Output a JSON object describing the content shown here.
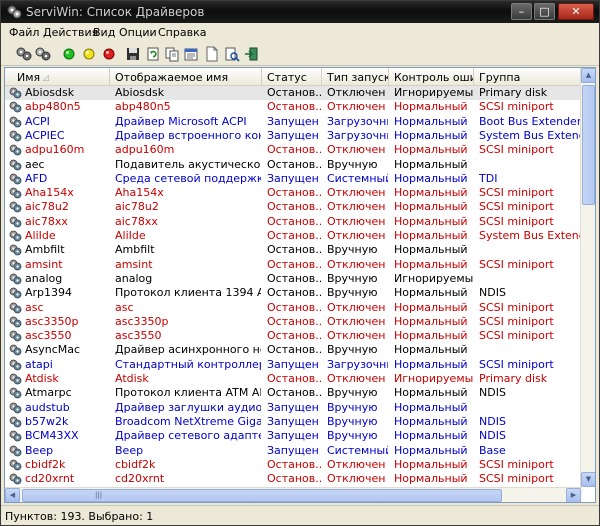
{
  "window": {
    "title": "ServiWin: Список Драйверов",
    "minimize_icon": "minimize-icon",
    "maximize_icon": "maximize-icon",
    "close_icon": "close-icon",
    "minimize_glyph": "–",
    "maximize_glyph": "□",
    "close_glyph": "✕"
  },
  "menu": [
    "Файл",
    "Действия",
    "Вид",
    "Опции",
    "Справка"
  ],
  "toolbar": {
    "icons": [
      "services-icon",
      "drivers-icon",
      "start-green-icon",
      "pause-yellow-icon",
      "stop-red-icon",
      "save-icon",
      "refresh-icon",
      "copy-icon",
      "properties-icon",
      "html-report-icon",
      "find-icon",
      "exit-icon"
    ]
  },
  "columns": [
    "Имя",
    "Отображаемое имя",
    "Статус",
    "Тип запуска",
    "Контроль оши...",
    "Группа"
  ],
  "colors": {
    "red": "#c80000",
    "blue": "#0000c8",
    "black": "#000000",
    "selected_bg": "#e6e6e6"
  },
  "rows": [
    {
      "name": "Abiosdsk",
      "display": "Abiosdsk",
      "status": "Останов...",
      "start": "Отключен",
      "error": "Игнорируемый",
      "group": "Primary disk",
      "color": "black",
      "selected": true
    },
    {
      "name": "abp480n5",
      "display": "abp480n5",
      "status": "Останов...",
      "start": "Отключен",
      "error": "Нормальный",
      "group": "SCSI miniport",
      "color": "red"
    },
    {
      "name": "ACPI",
      "display": "Драйвер Microsoft ACPI",
      "status": "Запущен",
      "start": "Загрузочный",
      "error": "Нормальный",
      "group": "Boot Bus Extender",
      "color": "blue"
    },
    {
      "name": "ACPIEC",
      "display": "Драйвер встроенного контрол...",
      "status": "Запущен",
      "start": "Загрузочный",
      "error": "Нормальный",
      "group": "System Bus Extender",
      "color": "blue"
    },
    {
      "name": "adpu160m",
      "display": "adpu160m",
      "status": "Останов...",
      "start": "Отключен",
      "error": "Нормальный",
      "group": "SCSI miniport",
      "color": "red"
    },
    {
      "name": "aec",
      "display": "Подавитель акустического эх...",
      "status": "Останов...",
      "start": "Вручную",
      "error": "Нормальный",
      "group": "",
      "color": "black"
    },
    {
      "name": "AFD",
      "display": "Среда сетевой поддержки AFD",
      "status": "Запущен",
      "start": "Системный",
      "error": "Нормальный",
      "group": "TDI",
      "color": "blue"
    },
    {
      "name": "Aha154x",
      "display": "Aha154x",
      "status": "Останов...",
      "start": "Отключен",
      "error": "Нормальный",
      "group": "SCSI miniport",
      "color": "red"
    },
    {
      "name": "aic78u2",
      "display": "aic78u2",
      "status": "Останов...",
      "start": "Отключен",
      "error": "Нормальный",
      "group": "SCSI miniport",
      "color": "red"
    },
    {
      "name": "aic78xx",
      "display": "aic78xx",
      "status": "Останов...",
      "start": "Отключен",
      "error": "Нормальный",
      "group": "SCSI miniport",
      "color": "red"
    },
    {
      "name": "AliIde",
      "display": "AliIde",
      "status": "Останов...",
      "start": "Отключен",
      "error": "Нормальный",
      "group": "System Bus Extender",
      "color": "red"
    },
    {
      "name": "Ambfilt",
      "display": "Ambfilt",
      "status": "Останов...",
      "start": "Вручную",
      "error": "Нормальный",
      "group": "",
      "color": "black"
    },
    {
      "name": "amsint",
      "display": "amsint",
      "status": "Останов...",
      "start": "Отключен",
      "error": "Нормальный",
      "group": "SCSI miniport",
      "color": "red"
    },
    {
      "name": "analog",
      "display": "analog",
      "status": "Останов...",
      "start": "Вручную",
      "error": "Игнорируемый",
      "group": "",
      "color": "black"
    },
    {
      "name": "Arp1394",
      "display": "Протокол клиента 1394 ARP",
      "status": "Останов...",
      "start": "Вручную",
      "error": "Нормальный",
      "group": "NDIS",
      "color": "black"
    },
    {
      "name": "asc",
      "display": "asc",
      "status": "Останов...",
      "start": "Отключен",
      "error": "Нормальный",
      "group": "SCSI miniport",
      "color": "red"
    },
    {
      "name": "asc3350p",
      "display": "asc3350p",
      "status": "Останов...",
      "start": "Отключен",
      "error": "Нормальный",
      "group": "SCSI miniport",
      "color": "red"
    },
    {
      "name": "asc3550",
      "display": "asc3550",
      "status": "Останов...",
      "start": "Отключен",
      "error": "Нормальный",
      "group": "SCSI miniport",
      "color": "red"
    },
    {
      "name": "AsyncMac",
      "display": "Драйвер асинхронного носите...",
      "status": "Останов...",
      "start": "Вручную",
      "error": "Нормальный",
      "group": "",
      "color": "black"
    },
    {
      "name": "atapi",
      "display": "Стандартный контроллер жес...",
      "status": "Запущен",
      "start": "Загрузочный",
      "error": "Нормальный",
      "group": "SCSI miniport",
      "color": "blue"
    },
    {
      "name": "Atdisk",
      "display": "Atdisk",
      "status": "Останов...",
      "start": "Отключен",
      "error": "Игнорируемый",
      "group": "Primary disk",
      "color": "red"
    },
    {
      "name": "Atmarpc",
      "display": "Протокол клиента ATM ARP",
      "status": "Останов...",
      "start": "Вручную",
      "error": "Нормальный",
      "group": "NDIS",
      "color": "black"
    },
    {
      "name": "audstub",
      "display": "Драйвер заглушки аудио",
      "status": "Запущен",
      "start": "Вручную",
      "error": "Нормальный",
      "group": "",
      "color": "blue"
    },
    {
      "name": "b57w2k",
      "display": "Broadcom NetXtreme Gigabit Eth...",
      "status": "Запущен",
      "start": "Вручную",
      "error": "Нормальный",
      "group": "NDIS",
      "color": "blue"
    },
    {
      "name": "BCM43XX",
      "display": "Драйвер сетевого адаптера B...",
      "status": "Запущен",
      "start": "Вручную",
      "error": "Нормальный",
      "group": "NDIS",
      "color": "blue"
    },
    {
      "name": "Beep",
      "display": "Beep",
      "status": "Запущен",
      "start": "Системный",
      "error": "Нормальный",
      "group": "Base",
      "color": "blue"
    },
    {
      "name": "cbidf2k",
      "display": "cbidf2k",
      "status": "Останов...",
      "start": "Отключен",
      "error": "Нормальный",
      "group": "SCSI miniport",
      "color": "red"
    },
    {
      "name": "cd20xrnt",
      "display": "cd20xrnt",
      "status": "Останов...",
      "start": "Отключен",
      "error": "Нормальный",
      "group": "SCSI miniport",
      "color": "red"
    }
  ],
  "scroll": {
    "up_glyph": "▲",
    "down_glyph": "▼",
    "left_glyph": "◀",
    "right_glyph": "▶",
    "thumb_glyph": "|||"
  },
  "status": "Пунктов: 193. Выбрано: 1"
}
